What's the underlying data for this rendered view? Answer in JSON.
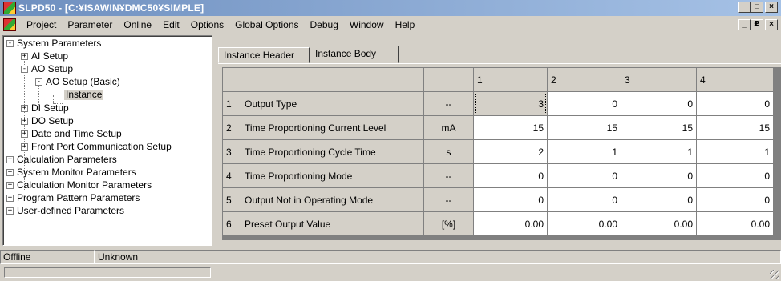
{
  "window": {
    "title": "SLPD50 - [C:¥ISAWIN¥DMC50¥SIMPLE]",
    "controls": [
      "_",
      "□",
      "×"
    ],
    "mdi_controls": [
      "_",
      "₽",
      "×"
    ]
  },
  "menu": [
    "Project",
    "Parameter",
    "Online",
    "Edit",
    "Options",
    "Global Options",
    "Debug",
    "Window",
    "Help"
  ],
  "tree": [
    {
      "label": "System Parameters",
      "expander": "-"
    },
    {
      "label": "AI Setup",
      "expander": "+"
    },
    {
      "label": "AO Setup",
      "expander": "-"
    },
    {
      "label": "AO Setup (Basic)",
      "expander": "-"
    },
    {
      "label": "Instance",
      "expander": ""
    },
    {
      "label": "DI Setup",
      "expander": "+"
    },
    {
      "label": "DO Setup",
      "expander": "+"
    },
    {
      "label": "Date and Time Setup",
      "expander": "+"
    },
    {
      "label": "Front Port Communication Setup",
      "expander": "+"
    },
    {
      "label": "Calculation Parameters",
      "expander": "+"
    },
    {
      "label": "System Monitor Parameters",
      "expander": "+"
    },
    {
      "label": "Calculation Monitor Parameters",
      "expander": "+"
    },
    {
      "label": "Program Pattern Parameters",
      "expander": "+"
    },
    {
      "label": "User-defined Parameters",
      "expander": "+"
    }
  ],
  "tabs": [
    "Instance Header",
    "Instance Body"
  ],
  "grid": {
    "columns": [
      "1",
      "2",
      "3",
      "4"
    ],
    "rows": [
      {
        "num": "1",
        "name": "Output Type",
        "unit": "--",
        "values": [
          "3",
          "0",
          "0",
          "0"
        ]
      },
      {
        "num": "2",
        "name": "Time Proportioning Current Level",
        "unit": "mA",
        "values": [
          "15",
          "15",
          "15",
          "15"
        ]
      },
      {
        "num": "3",
        "name": "Time Proportioning Cycle Time",
        "unit": "s",
        "values": [
          "2",
          "1",
          "1",
          "1"
        ]
      },
      {
        "num": "4",
        "name": "Time Proportioning Mode",
        "unit": "--",
        "values": [
          "0",
          "0",
          "0",
          "0"
        ]
      },
      {
        "num": "5",
        "name": "Output Not in Operating Mode",
        "unit": "--",
        "values": [
          "0",
          "0",
          "0",
          "0"
        ]
      },
      {
        "num": "6",
        "name": "Preset Output Value",
        "unit": "[%]",
        "values": [
          "0.00",
          "0.00",
          "0.00",
          "0.00"
        ]
      }
    ]
  },
  "status": {
    "connection": "Offline",
    "state": "Unknown"
  }
}
